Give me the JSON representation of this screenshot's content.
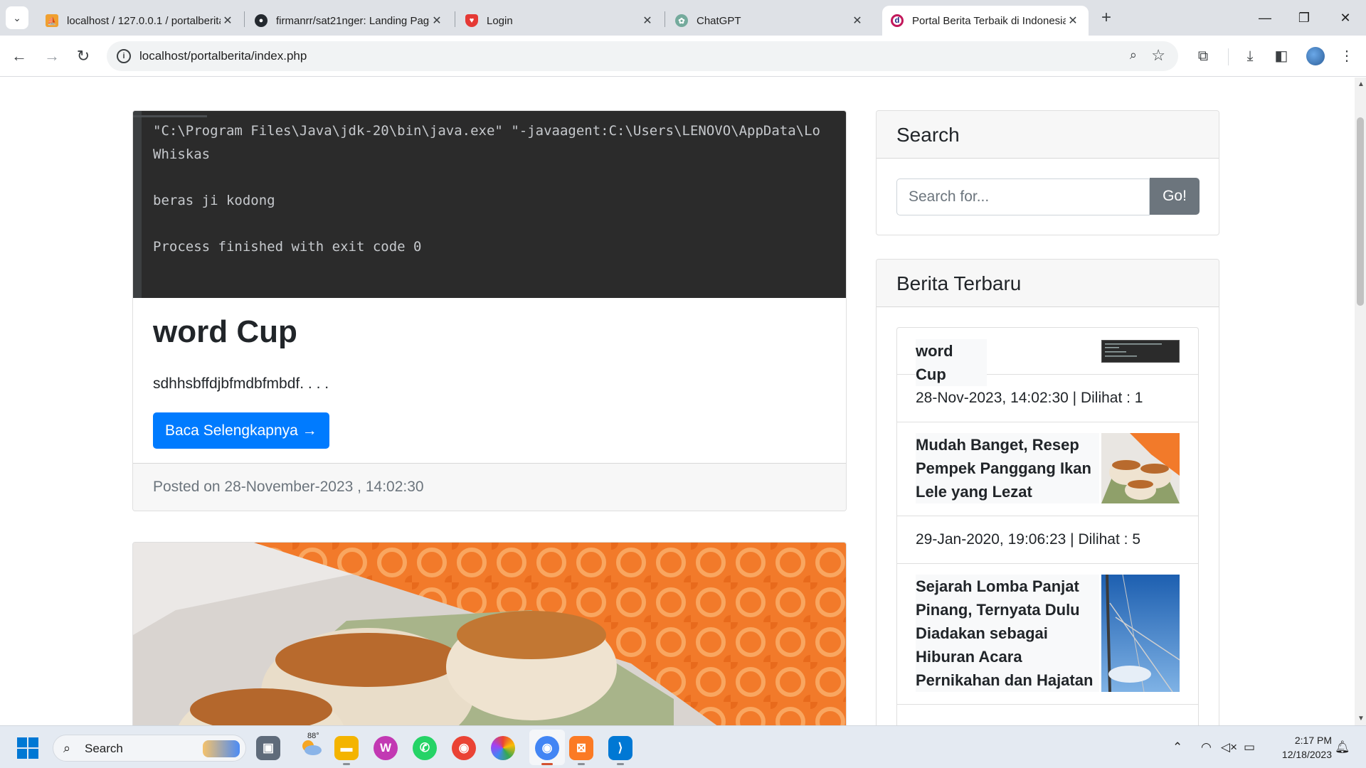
{
  "browser": {
    "tabs": [
      {
        "label": "localhost / 127.0.0.1 / portalberita",
        "favicon": "phpmyadmin-icon"
      },
      {
        "label": "firmanrr/sat21nger: Landing Page",
        "favicon": "github-icon"
      },
      {
        "label": "Login",
        "favicon": "shield-icon"
      },
      {
        "label": "ChatGPT",
        "favicon": "chatgpt-icon"
      },
      {
        "label": "Portal Berita Terbaik di Indonesia",
        "favicon": "site-icon"
      }
    ],
    "active_tab_index": 4,
    "url": "localhost/portalberita/index.php"
  },
  "page": {
    "posts": [
      {
        "code_lines": [
          "\"C:\\Program Files\\Java\\jdk-20\\bin\\java.exe\" \"-javaagent:C:\\Users\\LENOVO\\AppData\\Lo",
          "Whiskas",
          "beras ji kodong",
          "Process finished with exit code 0"
        ],
        "title": "word Cup",
        "excerpt": "sdhhsbffdjbfmdbfmbdf. . . .",
        "button_label": "Baca Selengkapnya →",
        "footer": "Posted on 28-November-2023 , 14:02:30"
      }
    ],
    "sidebar": {
      "search": {
        "heading": "Search",
        "placeholder": "Search for...",
        "button_label": "Go!"
      },
      "latest": {
        "heading": "Berita Terbaru",
        "items": [
          {
            "title": "word Cup",
            "meta": "28-Nov-2023, 14:02:30 | Dilihat : 1"
          },
          {
            "title": "Mudah Banget, Resep Pempek Panggang Ikan Lele yang Lezat",
            "meta": "29-Jan-2020, 19:06:23 | Dilihat : 5"
          },
          {
            "title": "Sejarah Lomba Panjat Pinang, Ternyata Dulu Diadakan sebagai Hiburan Acara Pernikahan dan Hajatan",
            "meta": ""
          }
        ]
      }
    }
  },
  "taskbar": {
    "search_label": "Search",
    "weather_temp": "88°",
    "time": "2:17 PM",
    "date": "12/18/2023"
  }
}
